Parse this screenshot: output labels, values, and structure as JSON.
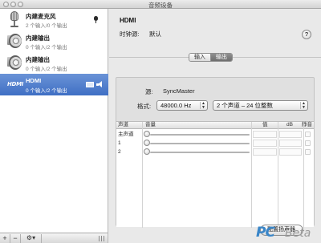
{
  "window": {
    "title": "音频设备"
  },
  "sidebar": {
    "devices": [
      {
        "name": "内建麦克风",
        "sub": "2 个输入/0 个输出",
        "icon": "microphone-icon",
        "selected": false
      },
      {
        "name": "内建输出",
        "sub": "0 个输入/2 个输出",
        "icon": "speaker-icon",
        "selected": false
      },
      {
        "name": "内建输出",
        "sub": "0 个输入/2 个输出",
        "icon": "speaker-icon",
        "selected": false
      },
      {
        "name": "HDMI",
        "sub": "0 个输入/2 个输出",
        "icon": "hdmi-icon",
        "logo": "HDMI",
        "selected": true
      }
    ],
    "footer": {
      "add": "+",
      "remove": "−",
      "gear": "⚙▾"
    }
  },
  "main": {
    "device_title": "HDMI",
    "clock_source_label": "时钟源:",
    "clock_source_value": "默认",
    "help": "?",
    "tabs": [
      {
        "label": "输入",
        "active": false
      },
      {
        "label": "输出",
        "active": true
      }
    ],
    "source_label": "源:",
    "source_value": "SyncMaster",
    "format_label": "格式:",
    "format_rate": "48000.0 Hz",
    "format_channels": "2 个声道 – 24 位整数",
    "table": {
      "headers": [
        "声道",
        "音量",
        "值",
        "dB",
        "静音"
      ],
      "rows": [
        {
          "name": "主声道",
          "volume": 0
        },
        {
          "name": "1",
          "volume": 0
        },
        {
          "name": "2",
          "volume": 0
        }
      ]
    },
    "config_button": "配置扬声器"
  },
  "watermark": {
    "pc": "PC",
    "beta": "Beta"
  },
  "colors": {
    "selection": "#3f6fc4",
    "watermark_blue": "#3a86c8"
  }
}
